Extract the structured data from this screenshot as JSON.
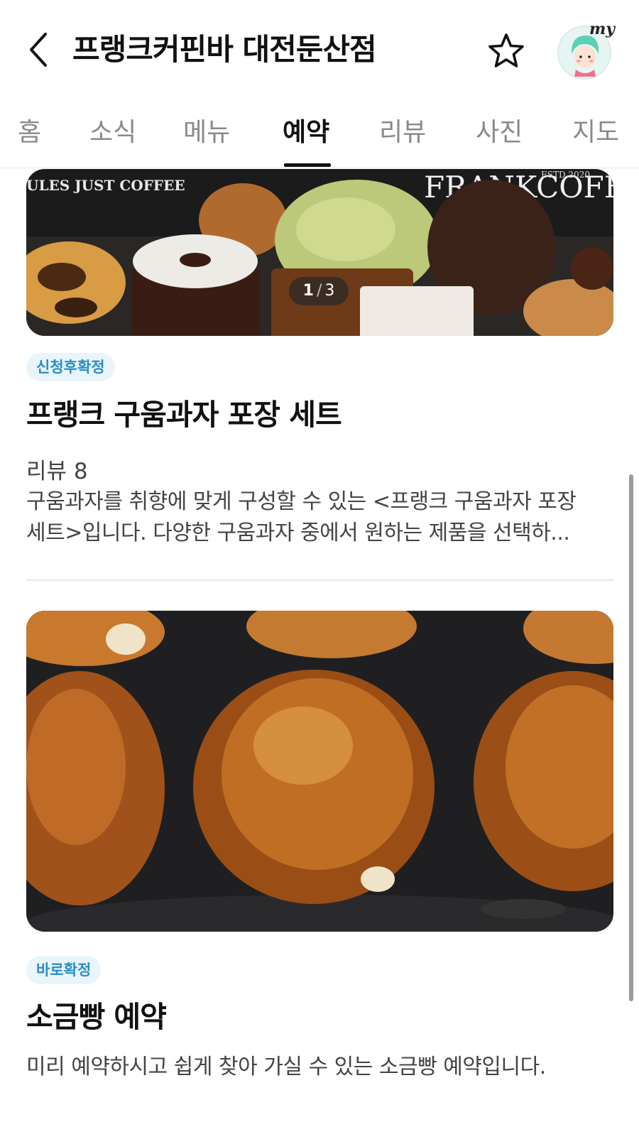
{
  "header": {
    "title": "프랭크커핀바 대전둔산점",
    "back_icon": "chevron-left-icon",
    "favorite_icon": "star-outline-icon",
    "avatar_text": "my"
  },
  "tabs": [
    {
      "label": "홈",
      "active": false
    },
    {
      "label": "소식",
      "active": false
    },
    {
      "label": "메뉴",
      "active": false
    },
    {
      "label": "예약",
      "active": true
    },
    {
      "label": "리뷰",
      "active": false
    },
    {
      "label": "사진",
      "active": false
    },
    {
      "label": "지도",
      "active": false
    }
  ],
  "items": [
    {
      "image_text_left": "ULES JUST COFFEE",
      "image_text_right": "FRANKCOFF",
      "image_text_estd": "ESTD 2020",
      "pager_current": "1",
      "pager_total": "3",
      "badge": "신청후확정",
      "title": "프랭크 구움과자 포장 세트",
      "review": "리뷰 8",
      "description_line1": "구움과자를 취향에 맞게 구성할 수 있는 <프랭크 구움과자 포장",
      "description_line2": "세트>입니다. 다양한 구움과자 중에서 원하는 제품을 선택하..."
    },
    {
      "badge": "바로확정",
      "title": "소금빵 예약",
      "description_line1": "미리 예약하시고 쉽게 찾아 가실 수 있는 소금빵 예약입니다."
    }
  ],
  "colors": {
    "badge_bg": "#e9f5fb",
    "badge_text": "#2a8ec4",
    "active_tab": "#111111",
    "inactive_tab": "#8a8a8a"
  }
}
